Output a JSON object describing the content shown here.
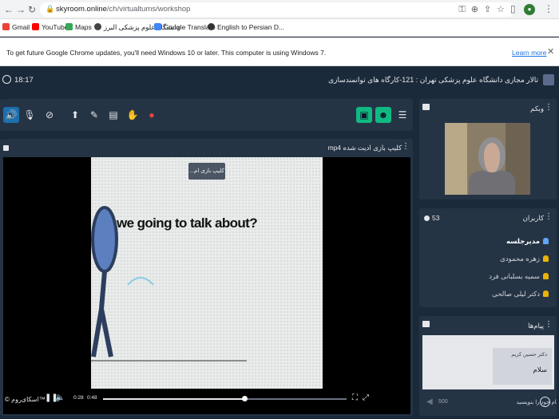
{
  "browser": {
    "url_domain": "skyroom.online",
    "url_path": "/ch/virtualtums/workshop",
    "bookmarks": [
      "Gmail",
      "YouTube",
      "Maps",
      "دانشگاه علوم پزشکی البرز",
      "Google Translate",
      "English to Persian D..."
    ],
    "bookmark_colors": [
      "#ea4335",
      "#ff0000",
      "#34a853",
      "#444444",
      "#4285f4",
      "#333333"
    ]
  },
  "infobar": {
    "message": "To get future Google Chrome updates, you'll need Windows 10 or later. This computer is using Windows 7.",
    "learn_more": "Learn more"
  },
  "app": {
    "time": "18:17",
    "room_title": "تالار مجازی دانشگاه علوم پزشکی تهران : 121-کارگاه های توانمندسازی",
    "toolbar_icons": [
      "speaker-icon",
      "microphone-icon",
      "camera-off-icon",
      "share-screen-icon",
      "pen-icon",
      "file-icon",
      "hand-icon",
      "record-icon",
      "chat-toggle-icon",
      "users-toggle-icon",
      "menu-icon"
    ]
  },
  "video": {
    "title": "کلیپ بازی ادیت شده mp4",
    "tooltip": "کلیپ بازی ام...",
    "frame_text": "we going to talk about?",
    "current_time": "0:28",
    "duration": "0:48",
    "progress": 0.58,
    "watermark": "© اسکای‌روم™"
  },
  "webcam": {
    "title": "وبکم"
  },
  "users": {
    "title": "کاربران",
    "count": "53",
    "list": [
      {
        "name": "مدیرجلسه",
        "role": "admin",
        "color": "#60a5fa"
      },
      {
        "name": "زهره محمودی",
        "role": "user",
        "color": "#eab308"
      },
      {
        "name": "سمیه بسلبانی فرد",
        "role": "user",
        "color": "#eab308"
      },
      {
        "name": "دکتر لیلی صالحی",
        "role": "user",
        "color": "#eab308"
      }
    ]
  },
  "messages": {
    "title": "پیام‌ها",
    "items": [
      {
        "name": "دکتر حسین کریم",
        "text": "سلام"
      }
    ],
    "input_placeholder": "پیام خود را بنویسید",
    "char_limit": "500"
  }
}
